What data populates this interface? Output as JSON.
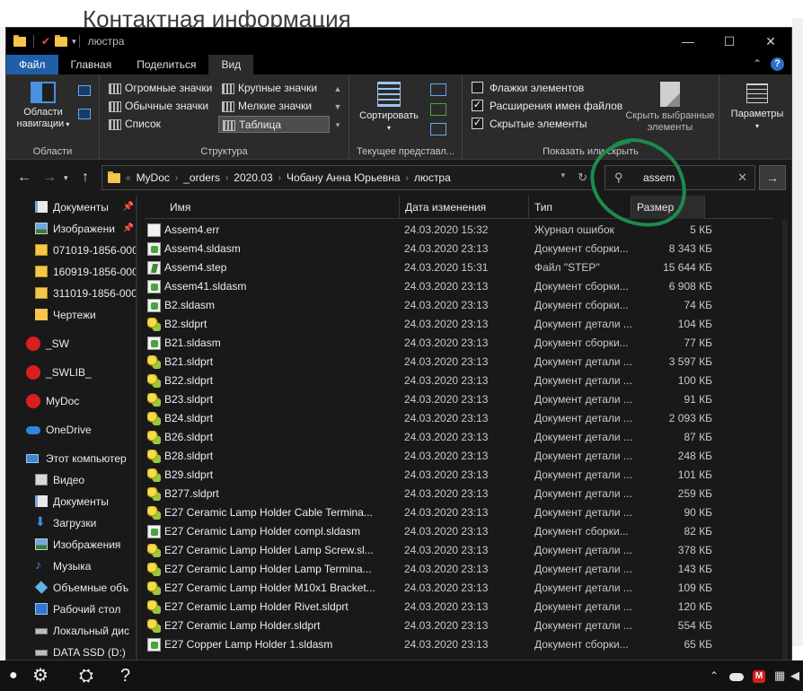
{
  "background": {
    "title_text": "Контактная информация"
  },
  "window": {
    "title": "люстра",
    "controls": {
      "minimize": "—",
      "maximize": "☐",
      "close": "✕"
    }
  },
  "ribbon": {
    "tabs": [
      "Файл",
      "Главная",
      "Поделиться",
      "Вид"
    ],
    "active_tab": "Вид",
    "panes": {
      "nav_pane_label": "Области навигации",
      "group_label": "Области"
    },
    "layout": {
      "items": [
        "Огромные значки",
        "Крупные значки",
        "Обычные значки",
        "Мелкие значки",
        "Список",
        "Таблица"
      ],
      "selected": "Таблица",
      "group_label": "Структура"
    },
    "current_view": {
      "sort_label": "Сортировать",
      "group_label": "Текущее представл..."
    },
    "show_hide": {
      "checkboxes": [
        {
          "label": "Флажки элементов",
          "checked": false
        },
        {
          "label": "Расширения имен файлов",
          "checked": true
        },
        {
          "label": "Скрытые элементы",
          "checked": true
        }
      ],
      "hide_selected_label": "Скрыть выбранные элементы",
      "group_label": "Показать или скрыть"
    },
    "options_label": "Параметры"
  },
  "address": {
    "crumbs": [
      "MyDoc",
      "_orders",
      "2020.03",
      "Чобану Анна Юрьевна",
      "люстра"
    ],
    "search_value": "assem"
  },
  "nav_pane": {
    "items": [
      {
        "label": "Документы",
        "icon": "documents-icon",
        "pinned": true
      },
      {
        "label": "Изображени",
        "icon": "pictures-icon",
        "pinned": true
      },
      {
        "label": "071019-1856-000",
        "icon": "zip-folder-icon",
        "pinned": false
      },
      {
        "label": "160919-1856-000",
        "icon": "zip-folder-icon",
        "pinned": false
      },
      {
        "label": "311019-1856-000",
        "icon": "zip-folder-icon",
        "pinned": false
      },
      {
        "label": "Чертежи",
        "icon": "folder-check-icon",
        "pinned": false
      },
      {
        "label": "_SW",
        "icon": "mega-icon",
        "pinned": false
      },
      {
        "label": "_SWLIB_",
        "icon": "mega-icon",
        "pinned": false
      },
      {
        "label": "MyDoc",
        "icon": "mega-icon",
        "pinned": false
      },
      {
        "label": "OneDrive",
        "icon": "onedrive-icon",
        "pinned": false
      },
      {
        "label": "Этот компьютер",
        "icon": "computer-icon",
        "pinned": false
      },
      {
        "label": "Видео",
        "icon": "video-icon",
        "pinned": false
      },
      {
        "label": "Документы",
        "icon": "documents-icon",
        "pinned": false
      },
      {
        "label": "Загрузки",
        "icon": "downloads-icon",
        "pinned": false
      },
      {
        "label": "Изображения",
        "icon": "pictures-icon",
        "pinned": false
      },
      {
        "label": "Музыка",
        "icon": "music-icon",
        "pinned": false
      },
      {
        "label": "Объемные объ",
        "icon": "3d-objects-icon",
        "pinned": false
      },
      {
        "label": "Рабочий стол",
        "icon": "desktop-icon",
        "pinned": false
      },
      {
        "label": "Локальный дис",
        "icon": "drive-icon",
        "pinned": false
      },
      {
        "label": "DATA SSD (D:)",
        "icon": "drive-icon",
        "pinned": false
      }
    ]
  },
  "file_list": {
    "columns": [
      "Имя",
      "Дата изменения",
      "Тип",
      "Размер"
    ],
    "rows": [
      {
        "name": "Assem4.err",
        "date": "24.03.2020 15:32",
        "type": "Журнал ошибок",
        "size": "5 КБ",
        "icon": "log-file-icon"
      },
      {
        "name": "Assem4.sldasm",
        "date": "24.03.2020 23:13",
        "type": "Документ сборки...",
        "size": "8 343 КБ",
        "icon": "assembly-file-icon"
      },
      {
        "name": "Assem4.step",
        "date": "24.03.2020 15:31",
        "type": "Файл \"STEP\"",
        "size": "15 644 КБ",
        "icon": "step-file-icon"
      },
      {
        "name": "Assem41.sldasm",
        "date": "24.03.2020 23:13",
        "type": "Документ сборки...",
        "size": "6 908 КБ",
        "icon": "assembly-file-icon"
      },
      {
        "name": "B2.sldasm",
        "date": "24.03.2020 23:13",
        "type": "Документ сборки...",
        "size": "74 КБ",
        "icon": "assembly-file-icon"
      },
      {
        "name": "B2.sldprt",
        "date": "24.03.2020 23:13",
        "type": "Документ детали ...",
        "size": "104 КБ",
        "icon": "part-file-icon"
      },
      {
        "name": "B21.sldasm",
        "date": "24.03.2020 23:13",
        "type": "Документ сборки...",
        "size": "77 КБ",
        "icon": "assembly-file-icon"
      },
      {
        "name": "B21.sldprt",
        "date": "24.03.2020 23:13",
        "type": "Документ детали ...",
        "size": "3 597 КБ",
        "icon": "part-file-icon"
      },
      {
        "name": "B22.sldprt",
        "date": "24.03.2020 23:13",
        "type": "Документ детали ...",
        "size": "100 КБ",
        "icon": "part-file-icon"
      },
      {
        "name": "B23.sldprt",
        "date": "24.03.2020 23:13",
        "type": "Документ детали ...",
        "size": "91 КБ",
        "icon": "part-file-icon"
      },
      {
        "name": "B24.sldprt",
        "date": "24.03.2020 23:13",
        "type": "Документ детали ...",
        "size": "2 093 КБ",
        "icon": "part-file-icon"
      },
      {
        "name": "B26.sldprt",
        "date": "24.03.2020 23:13",
        "type": "Документ детали ...",
        "size": "87 КБ",
        "icon": "part-file-icon"
      },
      {
        "name": "B28.sldprt",
        "date": "24.03.2020 23:13",
        "type": "Документ детали ...",
        "size": "248 КБ",
        "icon": "part-file-icon"
      },
      {
        "name": "B29.sldprt",
        "date": "24.03.2020 23:13",
        "type": "Документ детали ...",
        "size": "101 КБ",
        "icon": "part-file-icon"
      },
      {
        "name": "B277.sldprt",
        "date": "24.03.2020 23:13",
        "type": "Документ детали ...",
        "size": "259 КБ",
        "icon": "part-file-icon"
      },
      {
        "name": "E27 Ceramic Lamp Holder Cable Termina...",
        "date": "24.03.2020 23:13",
        "type": "Документ детали ...",
        "size": "90 КБ",
        "icon": "part-file-icon"
      },
      {
        "name": "E27 Ceramic Lamp Holder compl.sldasm",
        "date": "24.03.2020 23:13",
        "type": "Документ сборки...",
        "size": "82 КБ",
        "icon": "assembly-file-icon"
      },
      {
        "name": "E27 Ceramic Lamp Holder Lamp Screw.sl...",
        "date": "24.03.2020 23:13",
        "type": "Документ детали ...",
        "size": "378 КБ",
        "icon": "part-file-icon"
      },
      {
        "name": "E27 Ceramic Lamp Holder Lamp Termina...",
        "date": "24.03.2020 23:13",
        "type": "Документ детали ...",
        "size": "143 КБ",
        "icon": "part-file-icon"
      },
      {
        "name": "E27 Ceramic Lamp Holder M10x1 Bracket...",
        "date": "24.03.2020 23:13",
        "type": "Документ детали ...",
        "size": "109 КБ",
        "icon": "part-file-icon"
      },
      {
        "name": "E27 Ceramic Lamp Holder Rivet.sldprt",
        "date": "24.03.2020 23:13",
        "type": "Документ детали ...",
        "size": "120 КБ",
        "icon": "part-file-icon"
      },
      {
        "name": "E27 Ceramic Lamp Holder.sldprt",
        "date": "24.03.2020 23:13",
        "type": "Документ детали ...",
        "size": "554 КБ",
        "icon": "part-file-icon"
      },
      {
        "name": "E27 Copper Lamp Holder 1.sldasm",
        "date": "24.03.2020 23:13",
        "type": "Документ сборки...",
        "size": "65 КБ",
        "icon": "assembly-file-icon"
      }
    ]
  },
  "annotation": {
    "color": "#1e8a4c"
  },
  "colors": {
    "accent": "#1f5fa8",
    "window_bg": "#191919",
    "ribbon_bg": "#2b2b2b"
  }
}
